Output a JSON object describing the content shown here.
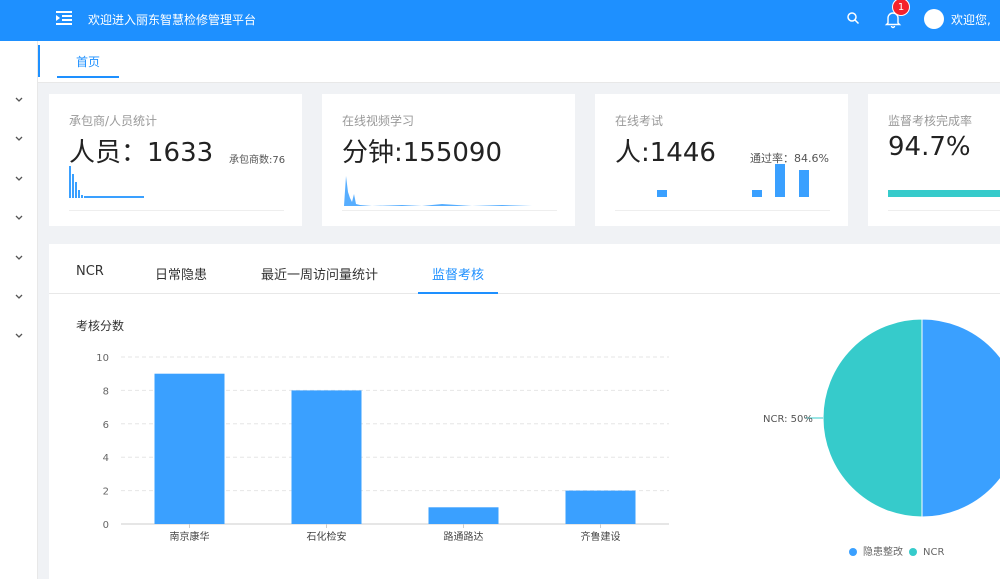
{
  "header": {
    "title": "欢迎进入丽东智慧检修管理平台",
    "notification_count": "1",
    "welcome": "欢迎您,"
  },
  "tabs": {
    "home": "首页"
  },
  "cards": [
    {
      "label": "承包商/人员统计",
      "value": "人员：1633",
      "sub": "承包商数:76"
    },
    {
      "label": "在线视频学习",
      "value": "分钟:155090"
    },
    {
      "label": "在线考试",
      "value": "人:1446",
      "sub": "通过率：84.6%"
    },
    {
      "label": "监督考核完成率",
      "value": "94.7%",
      "progress": 0.947
    }
  ],
  "panel_tabs": [
    "NCR",
    "日常隐患",
    "最近一周访问量统计",
    "监督考核"
  ],
  "active_panel_tab": "监督考核",
  "colors": {
    "accent": "#1e90ff",
    "bar": "#3aa0ff",
    "teal": "#36cbcb",
    "red": "#f5222d"
  },
  "chart_data": [
    {
      "type": "bar",
      "title": "考核分数",
      "categories": [
        "南京康华",
        "石化检安",
        "路通路达",
        "齐鲁建设"
      ],
      "values": [
        9,
        8,
        1,
        2
      ],
      "ylim": [
        0,
        10
      ],
      "yticks": [
        0,
        2,
        4,
        6,
        8,
        10
      ],
      "grid": true
    },
    {
      "type": "pie",
      "series": [
        {
          "name": "隐患整改",
          "value": 50,
          "color": "#3aa0ff"
        },
        {
          "name": "NCR",
          "value": 50,
          "color": "#36cbcb"
        }
      ],
      "label": "NCR: 50%",
      "legend": "bottom"
    }
  ]
}
